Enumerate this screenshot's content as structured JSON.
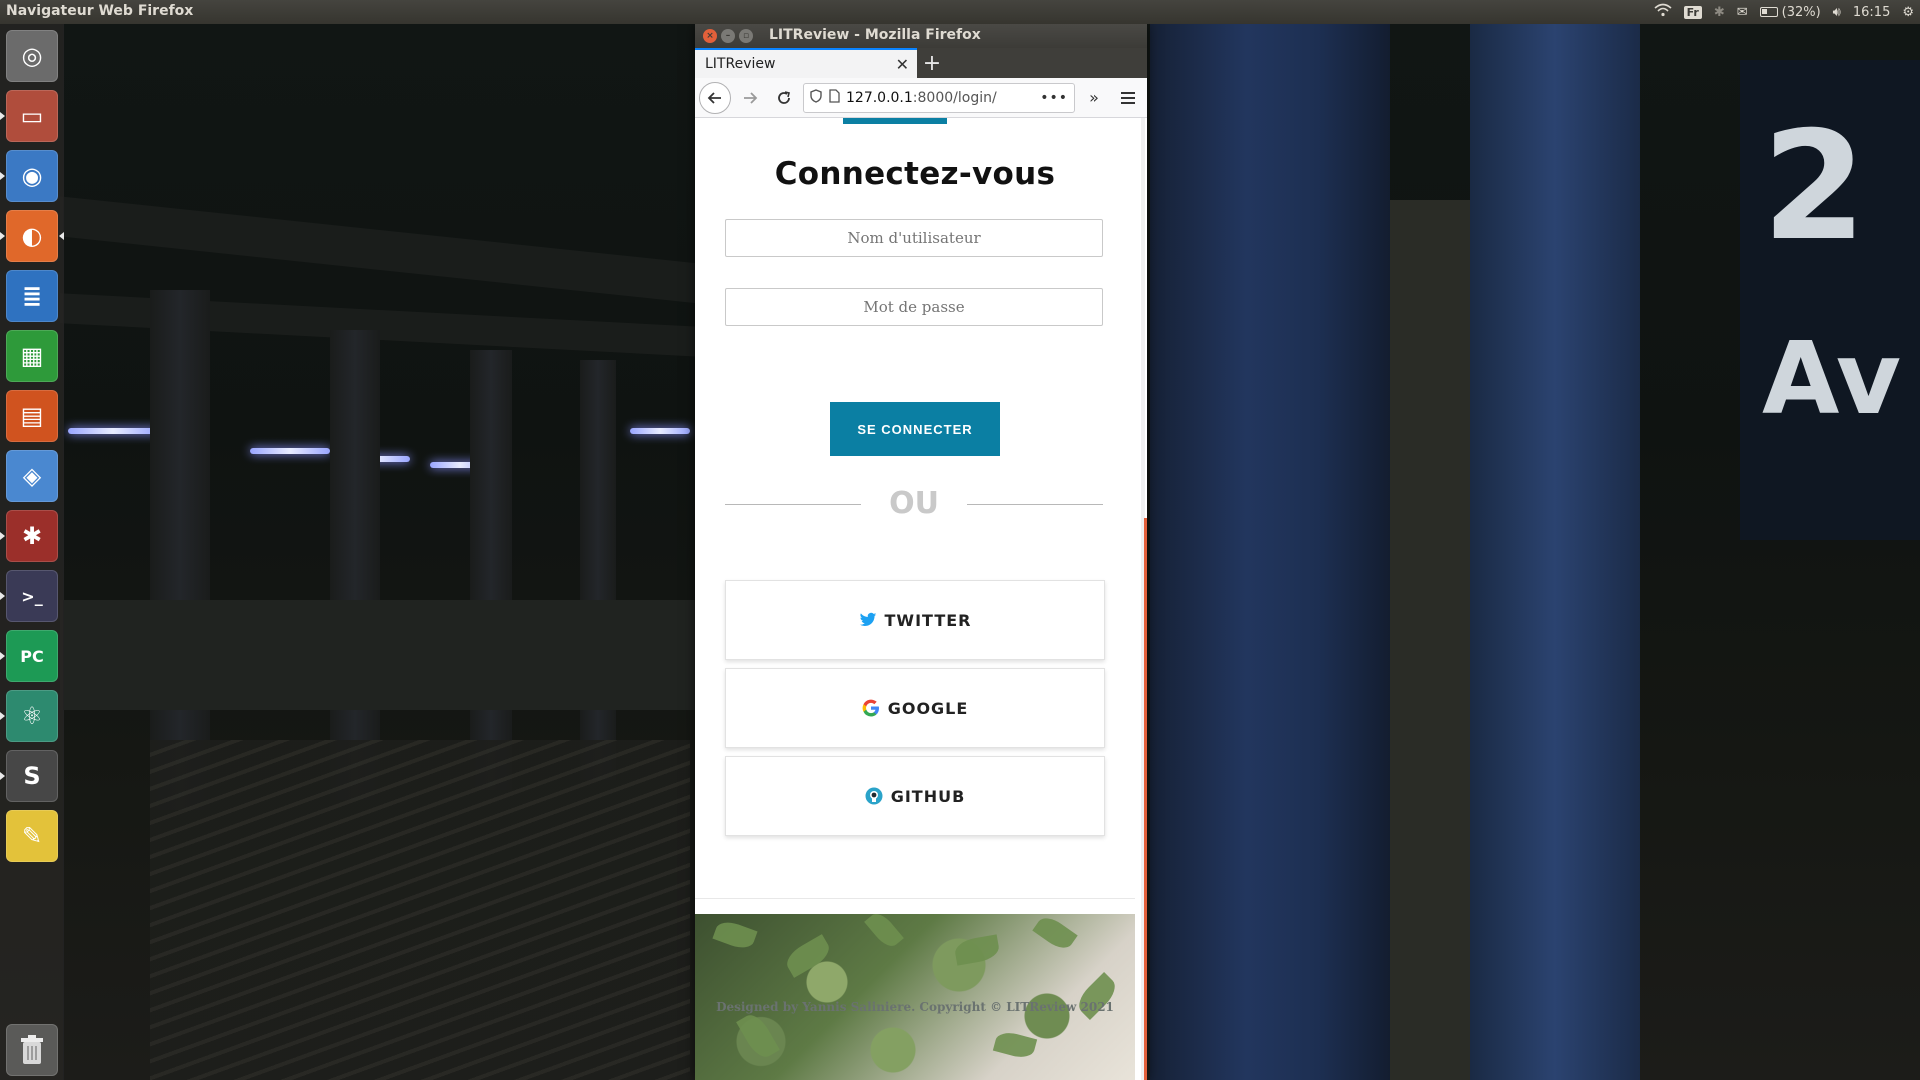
{
  "top_panel": {
    "app_name": "Navigateur Web Firefox",
    "keyboard_layout": "Fr",
    "battery_text": "(32%)",
    "clock": "16:15"
  },
  "launcher": {
    "items": [
      {
        "name": "ubuntu-dash-icon",
        "glyph": "◎",
        "color": "#6b6b6b"
      },
      {
        "name": "files-icon",
        "glyph": "▭",
        "color": "#b04d3c"
      },
      {
        "name": "chrome-icon",
        "glyph": "◉",
        "color": "#3b79c4"
      },
      {
        "name": "firefox-icon",
        "glyph": "◐",
        "color": "#e0682a"
      },
      {
        "name": "writer-icon",
        "glyph": "≣",
        "color": "#2f72c0"
      },
      {
        "name": "calc-icon",
        "glyph": "▦",
        "color": "#2e9a3a"
      },
      {
        "name": "impress-icon",
        "glyph": "▤",
        "color": "#d0531f"
      },
      {
        "name": "software-center-icon",
        "glyph": "◈",
        "color": "#4a88d0"
      },
      {
        "name": "settings-icon",
        "glyph": "✱",
        "color": "#9b2f2a"
      },
      {
        "name": "terminal-icon",
        "glyph": ">_",
        "color": "#3a3a56"
      },
      {
        "name": "pycharm-icon",
        "glyph": "PC",
        "color": "#1d9a55"
      },
      {
        "name": "atom-icon",
        "glyph": "⚛",
        "color": "#2d8a6f"
      },
      {
        "name": "sublime-icon",
        "glyph": "S",
        "color": "#474747"
      },
      {
        "name": "text-editor-icon",
        "glyph": "✎",
        "color": "#e3c23a"
      }
    ],
    "trash": {
      "name": "trash-icon",
      "glyph": "🗑"
    }
  },
  "firefox": {
    "window_title": "LITReview - Mozilla Firefox",
    "tab_title": "LITReview",
    "url_host": "127.0.0.1",
    "url_rest": ":8000/login/"
  },
  "login": {
    "title": "Connectez-vous",
    "username_placeholder": "Nom d'utilisateur",
    "password_placeholder": "Mot de passe",
    "submit_label": "SE CONNECTER",
    "divider_label": "OU",
    "social": [
      {
        "label": "TWITTER",
        "icon": "twitter-icon",
        "color": "#1da1f2"
      },
      {
        "label": "GOOGLE",
        "icon": "google-icon",
        "color": "#4285f4"
      },
      {
        "label": "GITHUB",
        "icon": "github-icon",
        "color": "#2aa3c9"
      }
    ],
    "footer_text": "Designed by Yannis Saliniere. Copyright © LITReview 2021"
  },
  "colors": {
    "primary": "#0b7fa3",
    "panel": "#3c3b37",
    "accent": "#e2603a"
  }
}
